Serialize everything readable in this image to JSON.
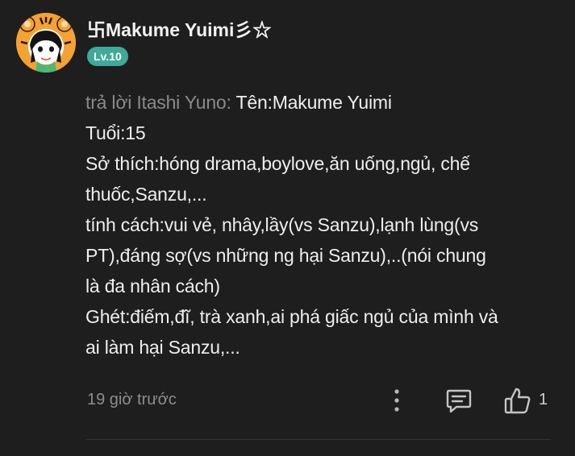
{
  "comment": {
    "author": {
      "name": "卐Makume Yuimi彡☆",
      "level": "Lv.10",
      "avatar_icon": "tiger-hood-girl-avatar"
    },
    "reply_prefix": "trả lời Itashi Yuno:",
    "lines": [
      "Tên:Makume Yuimi",
      "Tuổi:15",
      "Sở thích:hóng drama,boylove,ăn uống,ngủ, chế",
      "thuốc,Sanzu,...",
      "tính cách:vui vẻ, nhây,lầy(vs Sanzu),lạnh lùng(vs",
      "PT),đáng sợ(vs những ng hại Sanzu),..(nói chung",
      "là đa nhân cách)",
      "Ghét:điếm,đĩ, trà xanh,ai phá giấc ngủ của mình và",
      "ai làm hại Sanzu,..."
    ],
    "timestamp": "19 giờ trước",
    "like_count": "1",
    "actions": {
      "more_icon": "more-vertical-icon",
      "reply_icon": "comment-icon",
      "like_icon": "thumbs-up-icon"
    }
  },
  "colors": {
    "background": "#1e1e1e",
    "text": "#eeeeee",
    "muted": "#8d8d8d",
    "level_badge": "#3fa99a"
  }
}
